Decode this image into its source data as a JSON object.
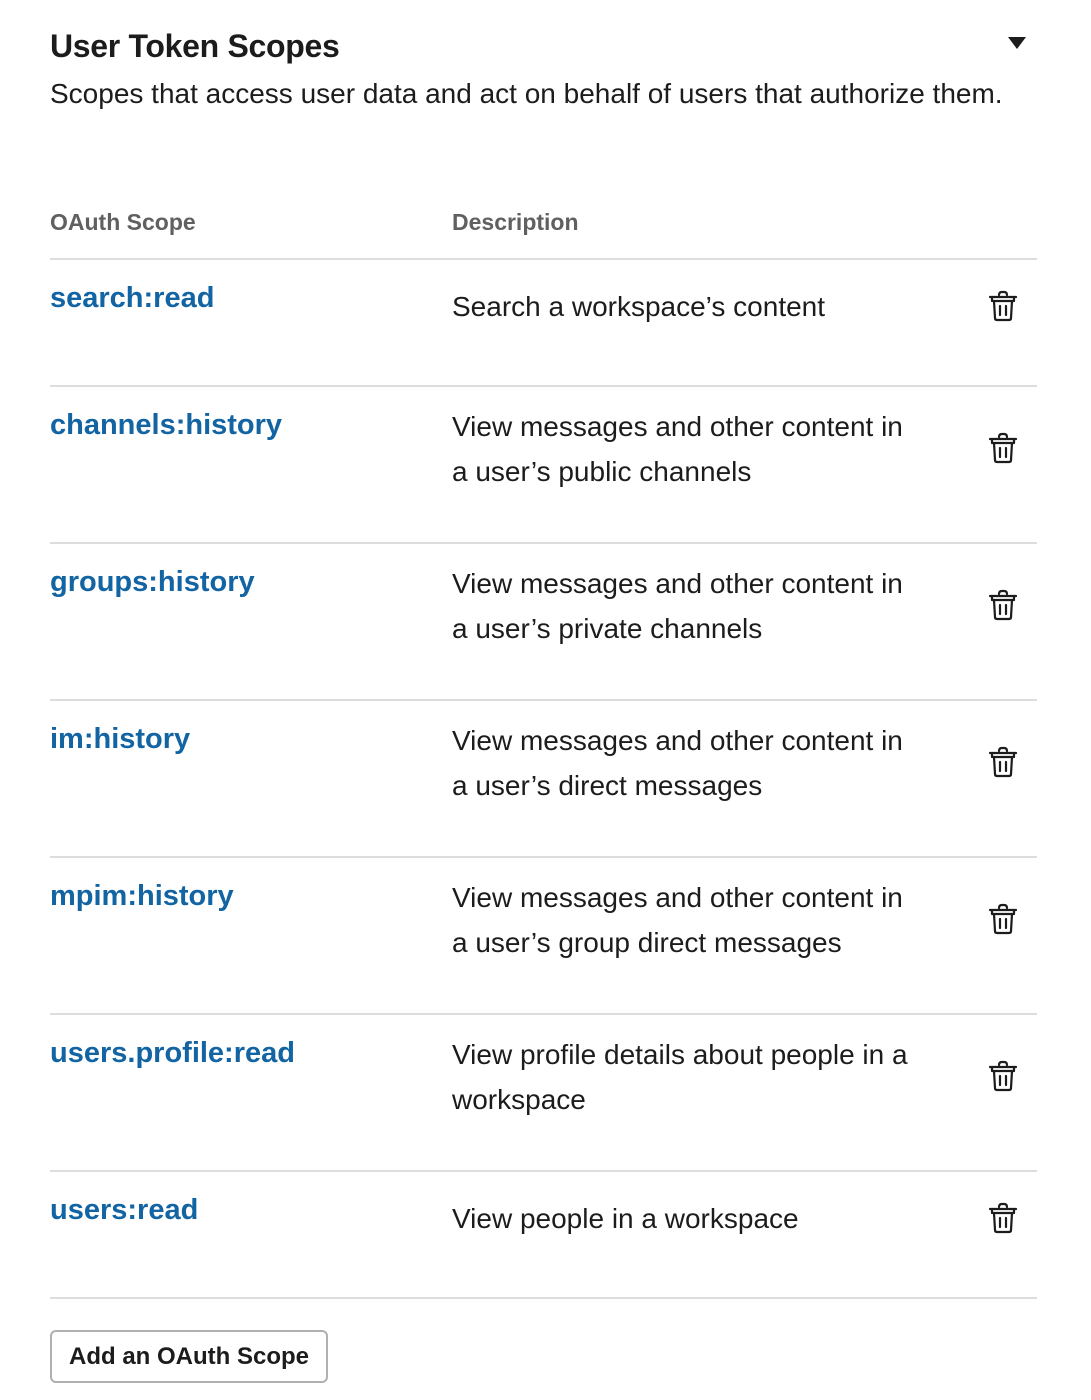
{
  "section": {
    "title": "User Token Scopes",
    "subtitle": "Scopes that access user data and act on behalf of users that authorize them.",
    "toggle_icon": "caret-down-icon"
  },
  "table": {
    "headers": {
      "scope": "OAuth Scope",
      "description": "Description"
    },
    "rows": [
      {
        "scope": "search:read",
        "description": "Search a workspace’s content",
        "action_icon": "trash-icon"
      },
      {
        "scope": "channels:history",
        "description": "View messages and other content in a user’s public channels",
        "action_icon": "trash-icon"
      },
      {
        "scope": "groups:history",
        "description": "View messages and other content in a user’s private channels",
        "action_icon": "trash-icon"
      },
      {
        "scope": "im:history",
        "description": "View messages and other content in a user’s direct messages",
        "action_icon": "trash-icon"
      },
      {
        "scope": "mpim:history",
        "description": "View messages and other content in a user’s group direct messages",
        "action_icon": "trash-icon"
      },
      {
        "scope": "users.profile:read",
        "description": "View profile details about people in a workspace",
        "action_icon": "trash-icon"
      },
      {
        "scope": "users:read",
        "description": "View people in a workspace",
        "action_icon": "trash-icon"
      }
    ]
  },
  "actions": {
    "add_scope_label": "Add an OAuth Scope"
  },
  "colors": {
    "link": "#1264a3",
    "text": "#1d1c1d",
    "muted": "#616061",
    "divider": "#dddddd"
  }
}
